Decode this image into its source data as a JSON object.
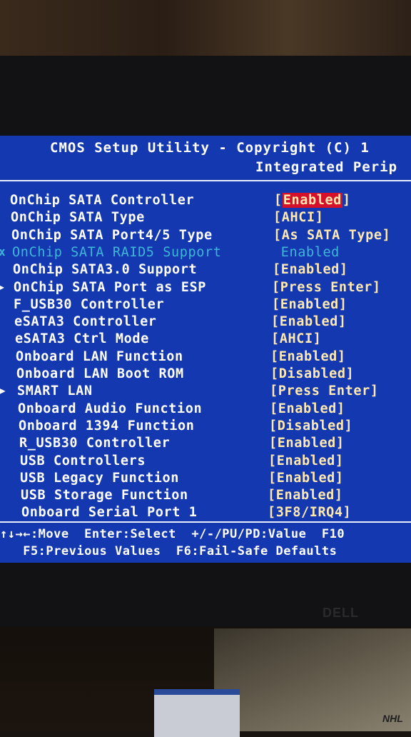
{
  "header": {
    "title": "CMOS Setup Utility - Copyright (C) 1",
    "subtitle": "Integrated Perip"
  },
  "menu": {
    "items": [
      {
        "label": "OnChip SATA Controller",
        "value": "Enabled",
        "pre": "[",
        "post": "]",
        "selected": true,
        "disabled": false,
        "marker": ""
      },
      {
        "label": "OnChip SATA Type",
        "value": "AHCI",
        "pre": "[",
        "post": "]",
        "selected": false,
        "disabled": false,
        "marker": ""
      },
      {
        "label": "OnChip SATA Port4/5 Type",
        "value": "As SATA Type",
        "pre": "[",
        "post": "]",
        "selected": false,
        "disabled": false,
        "marker": ""
      },
      {
        "label": "OnChip SATA RAID5 Support",
        "value": "Enabled",
        "pre": " ",
        "post": " ",
        "selected": false,
        "disabled": true,
        "marker": "x"
      },
      {
        "label": "OnChip SATA3.0 Support",
        "value": "Enabled",
        "pre": "[",
        "post": "]",
        "selected": false,
        "disabled": false,
        "marker": ""
      },
      {
        "label": "OnChip SATA Port as ESP",
        "value": "Press Enter",
        "pre": "[",
        "post": "]",
        "selected": false,
        "disabled": false,
        "marker": "▸"
      },
      {
        "label": "F_USB30 Controller",
        "value": "Enabled",
        "pre": "[",
        "post": "]",
        "selected": false,
        "disabled": false,
        "marker": ""
      },
      {
        "label": "eSATA3 Controller",
        "value": "Enabled",
        "pre": "[",
        "post": "]",
        "selected": false,
        "disabled": false,
        "marker": ""
      },
      {
        "label": "eSATA3 Ctrl Mode",
        "value": "AHCI",
        "pre": "[",
        "post": "]",
        "selected": false,
        "disabled": false,
        "marker": ""
      },
      {
        "label": "Onboard LAN Function",
        "value": "Enabled",
        "pre": "[",
        "post": "]",
        "selected": false,
        "disabled": false,
        "marker": ""
      },
      {
        "label": "Onboard LAN Boot ROM",
        "value": "Disabled",
        "pre": "[",
        "post": "]",
        "selected": false,
        "disabled": false,
        "marker": ""
      },
      {
        "label": "SMART LAN",
        "value": "Press Enter",
        "pre": "[",
        "post": "]",
        "selected": false,
        "disabled": false,
        "marker": "▶"
      },
      {
        "label": "Onboard Audio Function",
        "value": "Enabled",
        "pre": "[",
        "post": "]",
        "selected": false,
        "disabled": false,
        "marker": ""
      },
      {
        "label": "Onboard 1394 Function",
        "value": "Disabled",
        "pre": "[",
        "post": "]",
        "selected": false,
        "disabled": false,
        "marker": ""
      },
      {
        "label": "R_USB30 Controller",
        "value": "Enabled",
        "pre": "[",
        "post": "]",
        "selected": false,
        "disabled": false,
        "marker": ""
      },
      {
        "label": "USB Controllers",
        "value": "Enabled",
        "pre": "[",
        "post": "]",
        "selected": false,
        "disabled": false,
        "marker": ""
      },
      {
        "label": "USB Legacy Function",
        "value": "Enabled",
        "pre": "[",
        "post": "]",
        "selected": false,
        "disabled": false,
        "marker": ""
      },
      {
        "label": "USB Storage Function",
        "value": "Enabled",
        "pre": "[",
        "post": "]",
        "selected": false,
        "disabled": false,
        "marker": ""
      },
      {
        "label": "Onboard Serial Port 1",
        "value": "3F8/IRQ4",
        "pre": "[",
        "post": "]",
        "selected": false,
        "disabled": false,
        "marker": ""
      }
    ]
  },
  "footer": {
    "line1": "↑↓→←:Move  Enter:Select  +/-/PU/PD:Value  F10",
    "line2": "   F5:Previous Values  F6:Fail-Safe Defaults"
  },
  "monitor": {
    "brand": "DELL"
  },
  "desk": {
    "box_text": "NHL"
  },
  "colors": {
    "screen_bg": "#1438b0",
    "value_text": "#ffe9b0",
    "highlight_bg": "#d4102a",
    "disabled_text": "#3fb6d8"
  }
}
